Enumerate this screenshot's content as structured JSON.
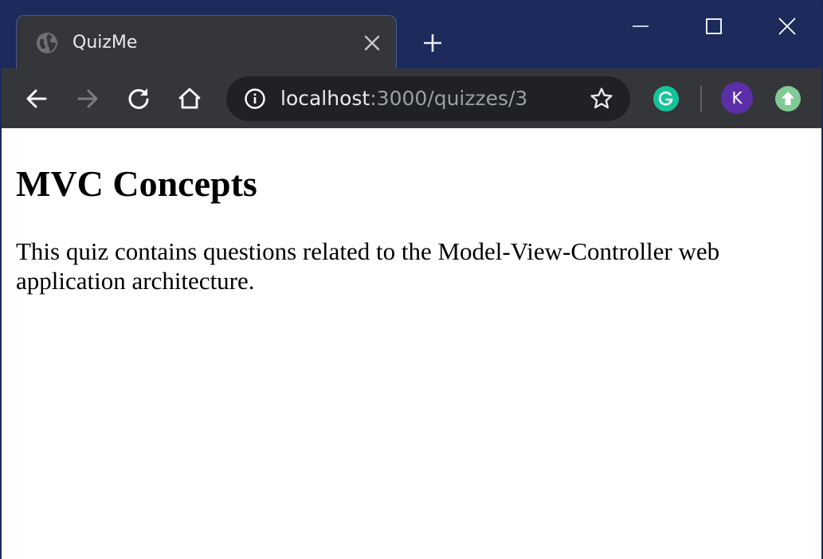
{
  "browser": {
    "tab": {
      "title": "QuizMe",
      "favicon": "globe-icon"
    },
    "address_bar": {
      "host": "localhost",
      "path": ":3000/quizzes/3"
    },
    "profile_initial": "K",
    "colors": {
      "frame": "#1c2b5c",
      "toolbar": "#35363a",
      "omnibox": "#202124",
      "grammarly": "#15c39a",
      "avatar": "#5b2fa8",
      "update": "#81c995"
    }
  },
  "page": {
    "title": "MVC Concepts",
    "description": "This quiz contains questions related to the Model-View-Controller web application architecture."
  }
}
